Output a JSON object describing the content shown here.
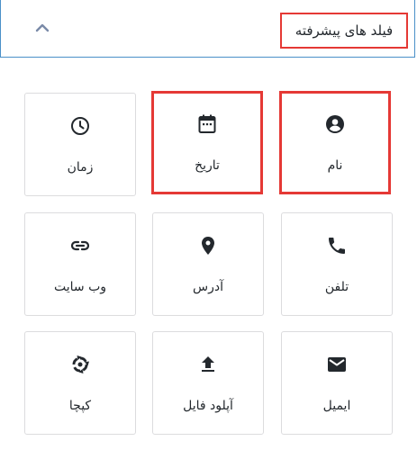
{
  "header": {
    "title": "فیلد های پیشرفته",
    "toggle_icon": "chevron-up-icon"
  },
  "fields": [
    {
      "label": "نام",
      "icon": "account-circle-icon",
      "highlighted": true
    },
    {
      "label": "تاریخ",
      "icon": "calendar-icon",
      "highlighted": true
    },
    {
      "label": "زمان",
      "icon": "clock-icon",
      "highlighted": false
    },
    {
      "label": "تلفن",
      "icon": "phone-icon",
      "highlighted": false
    },
    {
      "label": "آدرس",
      "icon": "map-pin-icon",
      "highlighted": false
    },
    {
      "label": "وب سایت",
      "icon": "link-icon",
      "highlighted": false
    },
    {
      "label": "ایمیل",
      "icon": "envelope-icon",
      "highlighted": false
    },
    {
      "label": "آپلود فایل",
      "icon": "upload-icon",
      "highlighted": false
    },
    {
      "label": "کپچا",
      "icon": "captcha-icon",
      "highlighted": false
    }
  ],
  "colors": {
    "icon": "#23282d",
    "highlight_border": "#e53935",
    "header_border": "#4a90c8",
    "tile_border": "#dcdcde",
    "toggle": "#7a8aa8"
  }
}
